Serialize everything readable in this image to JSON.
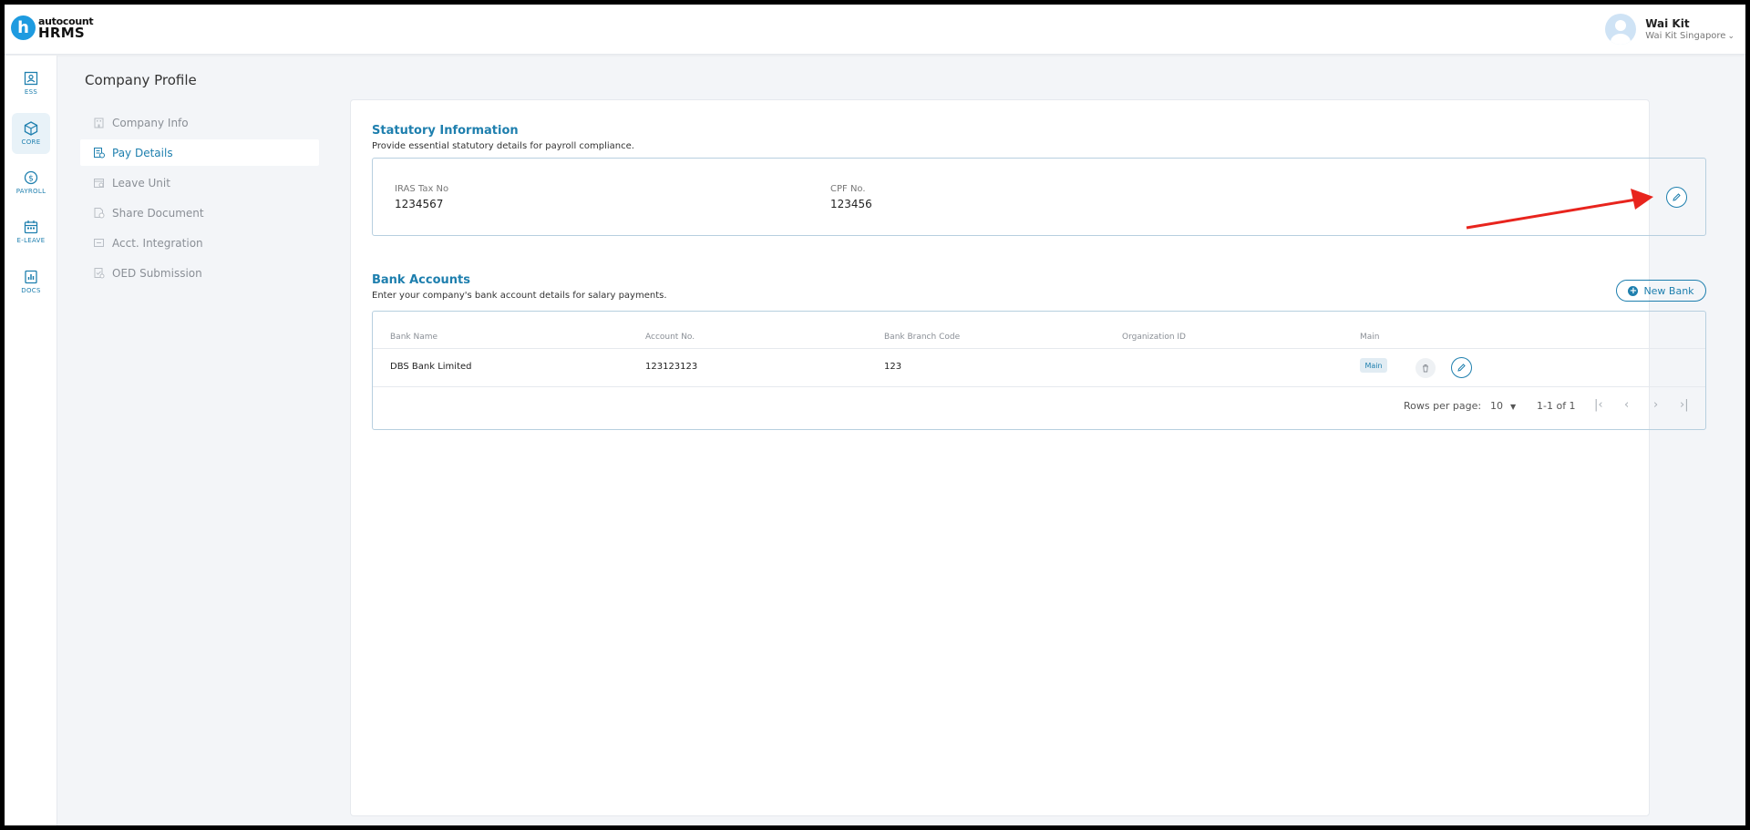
{
  "logo": {
    "mark": "h",
    "brand": "autocount",
    "product": "HRMS"
  },
  "user": {
    "name": "Wai Kit",
    "company": "Wai Kit Singapore"
  },
  "rail": [
    {
      "label": "ESS",
      "icon": "ess-icon"
    },
    {
      "label": "CORE",
      "icon": "core-icon"
    },
    {
      "label": "PAYROLL",
      "icon": "payroll-icon"
    },
    {
      "label": "E-LEAVE",
      "icon": "calendar-icon"
    },
    {
      "label": "DOCS",
      "icon": "docs-icon"
    }
  ],
  "page_title": "Company Profile",
  "subnav": [
    {
      "label": "Company Info"
    },
    {
      "label": "Pay Details"
    },
    {
      "label": "Leave Unit"
    },
    {
      "label": "Share Document"
    },
    {
      "label": "Acct. Integration"
    },
    {
      "label": "OED Submission"
    }
  ],
  "statutory": {
    "title": "Statutory Information",
    "subtitle": "Provide essential statutory details for payroll compliance.",
    "iras_label": "IRAS Tax No",
    "iras_value": "1234567",
    "cpf_label": "CPF No.",
    "cpf_value": "123456"
  },
  "bank": {
    "title": "Bank Accounts",
    "subtitle": "Enter your company's bank account details for salary payments.",
    "new_button": "New Bank",
    "headers": [
      "Bank Name",
      "Account No.",
      "Bank Branch Code",
      "Organization ID",
      "Main"
    ],
    "rows": [
      {
        "bank_name": "DBS Bank Limited",
        "account_no": "123123123",
        "branch_code": "123",
        "org_id": "",
        "main": "Main"
      }
    ],
    "rows_per_page_label": "Rows per page:",
    "rows_per_page": "10",
    "range": "1-1 of 1"
  },
  "colors": {
    "accent": "#1e7fae",
    "annotation_arrow": "#e8241d"
  }
}
